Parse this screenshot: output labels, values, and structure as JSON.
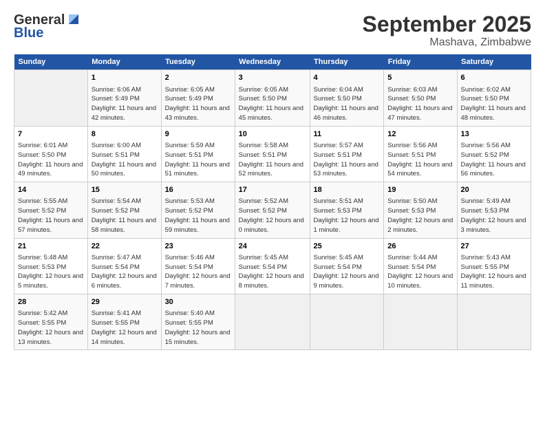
{
  "header": {
    "logo_line1": "General",
    "logo_line2": "Blue",
    "month": "September 2025",
    "location": "Mashava, Zimbabwe"
  },
  "columns": [
    "Sunday",
    "Monday",
    "Tuesday",
    "Wednesday",
    "Thursday",
    "Friday",
    "Saturday"
  ],
  "weeks": [
    [
      {
        "day": "",
        "sunrise": "",
        "sunset": "",
        "daylight": ""
      },
      {
        "day": "1",
        "sunrise": "Sunrise: 6:06 AM",
        "sunset": "Sunset: 5:49 PM",
        "daylight": "Daylight: 11 hours and 42 minutes."
      },
      {
        "day": "2",
        "sunrise": "Sunrise: 6:05 AM",
        "sunset": "Sunset: 5:49 PM",
        "daylight": "Daylight: 11 hours and 43 minutes."
      },
      {
        "day": "3",
        "sunrise": "Sunrise: 6:05 AM",
        "sunset": "Sunset: 5:50 PM",
        "daylight": "Daylight: 11 hours and 45 minutes."
      },
      {
        "day": "4",
        "sunrise": "Sunrise: 6:04 AM",
        "sunset": "Sunset: 5:50 PM",
        "daylight": "Daylight: 11 hours and 46 minutes."
      },
      {
        "day": "5",
        "sunrise": "Sunrise: 6:03 AM",
        "sunset": "Sunset: 5:50 PM",
        "daylight": "Daylight: 11 hours and 47 minutes."
      },
      {
        "day": "6",
        "sunrise": "Sunrise: 6:02 AM",
        "sunset": "Sunset: 5:50 PM",
        "daylight": "Daylight: 11 hours and 48 minutes."
      }
    ],
    [
      {
        "day": "7",
        "sunrise": "Sunrise: 6:01 AM",
        "sunset": "Sunset: 5:50 PM",
        "daylight": "Daylight: 11 hours and 49 minutes."
      },
      {
        "day": "8",
        "sunrise": "Sunrise: 6:00 AM",
        "sunset": "Sunset: 5:51 PM",
        "daylight": "Daylight: 11 hours and 50 minutes."
      },
      {
        "day": "9",
        "sunrise": "Sunrise: 5:59 AM",
        "sunset": "Sunset: 5:51 PM",
        "daylight": "Daylight: 11 hours and 51 minutes."
      },
      {
        "day": "10",
        "sunrise": "Sunrise: 5:58 AM",
        "sunset": "Sunset: 5:51 PM",
        "daylight": "Daylight: 11 hours and 52 minutes."
      },
      {
        "day": "11",
        "sunrise": "Sunrise: 5:57 AM",
        "sunset": "Sunset: 5:51 PM",
        "daylight": "Daylight: 11 hours and 53 minutes."
      },
      {
        "day": "12",
        "sunrise": "Sunrise: 5:56 AM",
        "sunset": "Sunset: 5:51 PM",
        "daylight": "Daylight: 11 hours and 54 minutes."
      },
      {
        "day": "13",
        "sunrise": "Sunrise: 5:56 AM",
        "sunset": "Sunset: 5:52 PM",
        "daylight": "Daylight: 11 hours and 56 minutes."
      }
    ],
    [
      {
        "day": "14",
        "sunrise": "Sunrise: 5:55 AM",
        "sunset": "Sunset: 5:52 PM",
        "daylight": "Daylight: 11 hours and 57 minutes."
      },
      {
        "day": "15",
        "sunrise": "Sunrise: 5:54 AM",
        "sunset": "Sunset: 5:52 PM",
        "daylight": "Daylight: 11 hours and 58 minutes."
      },
      {
        "day": "16",
        "sunrise": "Sunrise: 5:53 AM",
        "sunset": "Sunset: 5:52 PM",
        "daylight": "Daylight: 11 hours and 59 minutes."
      },
      {
        "day": "17",
        "sunrise": "Sunrise: 5:52 AM",
        "sunset": "Sunset: 5:52 PM",
        "daylight": "Daylight: 12 hours and 0 minutes."
      },
      {
        "day": "18",
        "sunrise": "Sunrise: 5:51 AM",
        "sunset": "Sunset: 5:53 PM",
        "daylight": "Daylight: 12 hours and 1 minute."
      },
      {
        "day": "19",
        "sunrise": "Sunrise: 5:50 AM",
        "sunset": "Sunset: 5:53 PM",
        "daylight": "Daylight: 12 hours and 2 minutes."
      },
      {
        "day": "20",
        "sunrise": "Sunrise: 5:49 AM",
        "sunset": "Sunset: 5:53 PM",
        "daylight": "Daylight: 12 hours and 3 minutes."
      }
    ],
    [
      {
        "day": "21",
        "sunrise": "Sunrise: 5:48 AM",
        "sunset": "Sunset: 5:53 PM",
        "daylight": "Daylight: 12 hours and 5 minutes."
      },
      {
        "day": "22",
        "sunrise": "Sunrise: 5:47 AM",
        "sunset": "Sunset: 5:54 PM",
        "daylight": "Daylight: 12 hours and 6 minutes."
      },
      {
        "day": "23",
        "sunrise": "Sunrise: 5:46 AM",
        "sunset": "Sunset: 5:54 PM",
        "daylight": "Daylight: 12 hours and 7 minutes."
      },
      {
        "day": "24",
        "sunrise": "Sunrise: 5:45 AM",
        "sunset": "Sunset: 5:54 PM",
        "daylight": "Daylight: 12 hours and 8 minutes."
      },
      {
        "day": "25",
        "sunrise": "Sunrise: 5:45 AM",
        "sunset": "Sunset: 5:54 PM",
        "daylight": "Daylight: 12 hours and 9 minutes."
      },
      {
        "day": "26",
        "sunrise": "Sunrise: 5:44 AM",
        "sunset": "Sunset: 5:54 PM",
        "daylight": "Daylight: 12 hours and 10 minutes."
      },
      {
        "day": "27",
        "sunrise": "Sunrise: 5:43 AM",
        "sunset": "Sunset: 5:55 PM",
        "daylight": "Daylight: 12 hours and 11 minutes."
      }
    ],
    [
      {
        "day": "28",
        "sunrise": "Sunrise: 5:42 AM",
        "sunset": "Sunset: 5:55 PM",
        "daylight": "Daylight: 12 hours and 13 minutes."
      },
      {
        "day": "29",
        "sunrise": "Sunrise: 5:41 AM",
        "sunset": "Sunset: 5:55 PM",
        "daylight": "Daylight: 12 hours and 14 minutes."
      },
      {
        "day": "30",
        "sunrise": "Sunrise: 5:40 AM",
        "sunset": "Sunset: 5:55 PM",
        "daylight": "Daylight: 12 hours and 15 minutes."
      },
      {
        "day": "",
        "sunrise": "",
        "sunset": "",
        "daylight": ""
      },
      {
        "day": "",
        "sunrise": "",
        "sunset": "",
        "daylight": ""
      },
      {
        "day": "",
        "sunrise": "",
        "sunset": "",
        "daylight": ""
      },
      {
        "day": "",
        "sunrise": "",
        "sunset": "",
        "daylight": ""
      }
    ]
  ]
}
